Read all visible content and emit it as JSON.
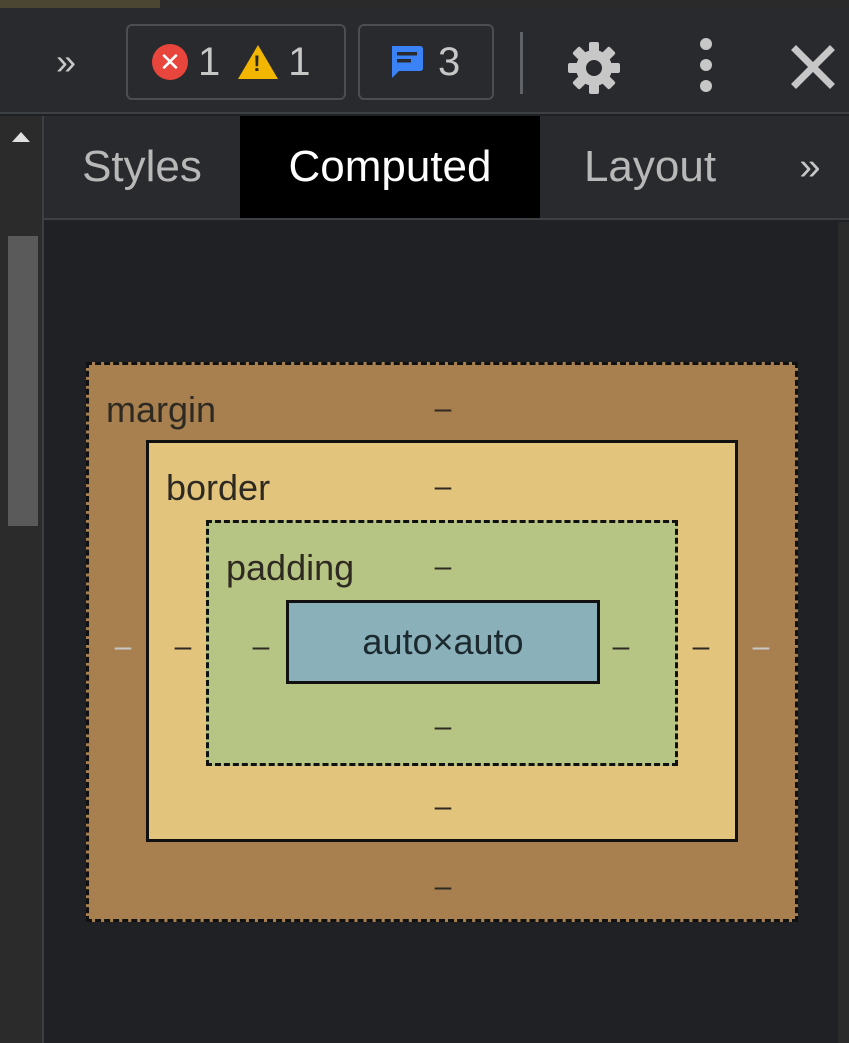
{
  "toolbar": {
    "more_tools": "»",
    "errors_count": "1",
    "warnings_count": "1",
    "messages_count": "3",
    "error_glyph": "✕",
    "warning_glyph": "!"
  },
  "tabs": [
    {
      "label": "Styles",
      "active": false
    },
    {
      "label": "Computed",
      "active": true
    },
    {
      "label": "Layout",
      "active": false
    },
    {
      "label": "»",
      "active": false
    }
  ],
  "box_model": {
    "margin": {
      "label": "margin",
      "top": "–",
      "right": "–",
      "bottom": "–",
      "left": "–"
    },
    "border": {
      "label": "border",
      "top": "–",
      "right": "–",
      "bottom": "–",
      "left": "–"
    },
    "padding": {
      "label": "padding",
      "top": "–",
      "right": "–",
      "bottom": "–",
      "left": "–"
    },
    "content": "auto×auto",
    "outer_left": "–",
    "outer_right": "–"
  },
  "colors": {
    "margin": "#a87f4f",
    "border": "#e2c47c",
    "padding": "#b7c584",
    "content": "#8ab0ba",
    "error": "#e8453c",
    "warning": "#f2b600",
    "message": "#3b82f6"
  }
}
